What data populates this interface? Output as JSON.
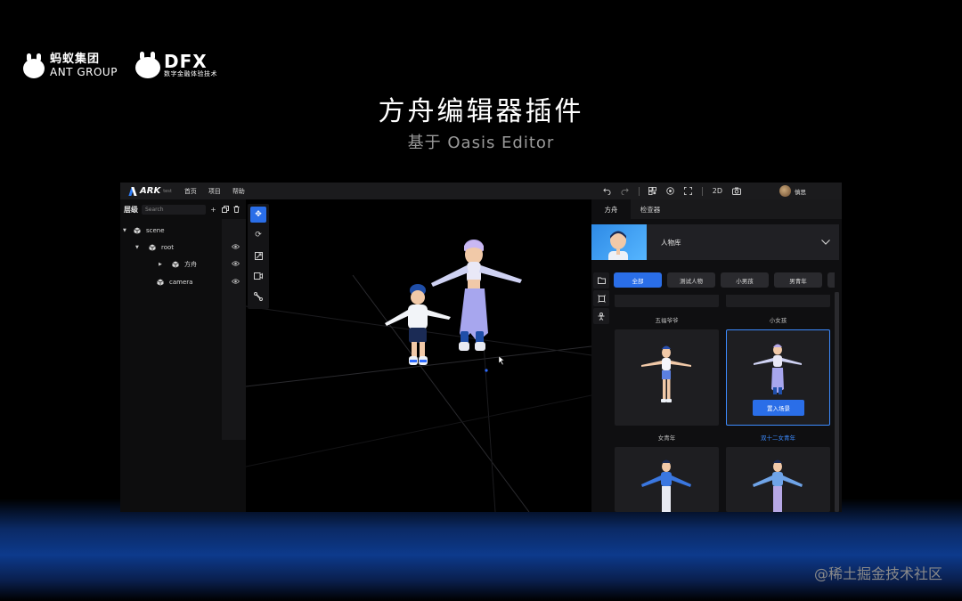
{
  "slide": {
    "title": "方舟编辑器插件",
    "subtitle": "基于 Oasis Editor",
    "watermark": "@稀土掘金技术社区",
    "logos": {
      "ant_cn": "蚂蚁集团",
      "ant_en": "ANT GROUP",
      "dfx_big": "DFX",
      "dfx_small": "数字金融体验技术"
    }
  },
  "app": {
    "brand": "ARK",
    "brand_tag": "test",
    "menu": [
      "首页",
      "项目",
      "帮助"
    ],
    "toolbar": {
      "undo_icon": "undo-icon",
      "redo_icon": "redo-icon",
      "qr_icon": "qrcode-icon",
      "preview_icon": "eye-circle-icon",
      "fullscreen_icon": "fullscreen-icon",
      "mode_label": "2D",
      "camera_icon": "camera-icon"
    },
    "user": {
      "name": "慎思"
    },
    "hierarchy": {
      "title": "层级",
      "search_placeholder": "Search",
      "items": [
        {
          "label": "scene",
          "depth": 0,
          "expanded": true,
          "has_eye": false
        },
        {
          "label": "root",
          "depth": 1,
          "expanded": true,
          "has_eye": true
        },
        {
          "label": "方舟",
          "depth": 2,
          "expanded": false,
          "has_eye": true
        },
        {
          "label": "camera",
          "depth": 1,
          "expanded": null,
          "has_eye": true
        }
      ]
    },
    "tools": [
      "move-icon",
      "rotate-icon",
      "scale-icon",
      "camera-view-icon",
      "bone-icon"
    ],
    "right_panel": {
      "tabs": [
        {
          "label": "方舟",
          "active": true
        },
        {
          "label": "检查器",
          "active": false
        }
      ],
      "library_title": "人物库",
      "filters": [
        {
          "label": "全部",
          "active": true
        },
        {
          "label": "测试人物",
          "active": false
        },
        {
          "label": "小男孩",
          "active": false
        },
        {
          "label": "男青年",
          "active": false
        }
      ],
      "top_labels": [
        "五福爷爷",
        "小女孩"
      ],
      "cards": [
        {
          "label": "女青年",
          "selected": false
        },
        {
          "label": "双十二女青年",
          "selected": true,
          "action": "置入场景"
        },
        {
          "label": "",
          "selected": false
        },
        {
          "label": "",
          "selected": false
        }
      ]
    }
  },
  "colors": {
    "accent": "#2a6ee8",
    "selected": "#3d8bff",
    "panel": "#0f0f11"
  }
}
